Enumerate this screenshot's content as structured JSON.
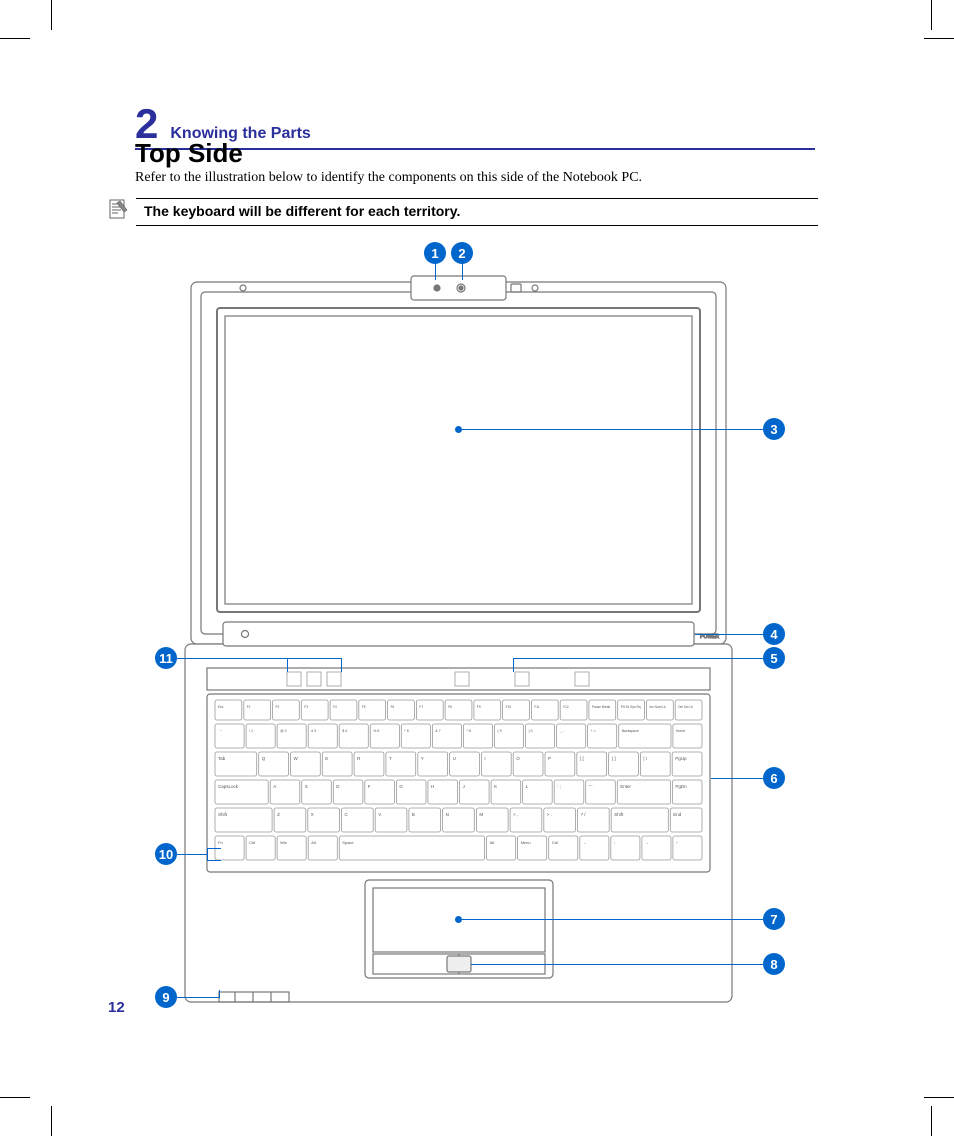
{
  "page_number": "12",
  "chapter": {
    "number": "2",
    "title": "Knowing the Parts"
  },
  "section": {
    "title": "Top Side",
    "intro": "Refer to the illustration below to identify the components on this side of the Notebook PC."
  },
  "note": {
    "text": "The keyboard will be different for each territory."
  },
  "callouts": {
    "c1": "1",
    "c2": "2",
    "c3": "3",
    "c4": "4",
    "c5": "5",
    "c6": "6",
    "c7": "7",
    "c8": "8",
    "c9": "9",
    "c10": "10",
    "c11": "11"
  },
  "labels": {
    "power": "POWER"
  },
  "keyboard": {
    "row_fn": [
      "Esc",
      "F1",
      "F2",
      "F3",
      "F4",
      "F5",
      "F6",
      "F7",
      "F8",
      "F9",
      "F10",
      "F11",
      "F12",
      "Pause Break",
      "Prt Sc Sys Rq",
      "Ins Num Lk",
      "Del Scr Lk"
    ],
    "row_num": [
      "` ~",
      "! 1",
      "@ 2",
      "# 3",
      "$ 4",
      "% 5",
      "^ 6",
      "& 7",
      "* 8",
      "( 9",
      ") 0",
      "_ -",
      "+ =",
      "Backspace",
      "Home"
    ],
    "row_q": [
      "Tab",
      "Q",
      "W",
      "E",
      "R",
      "T",
      "Y",
      "U",
      "I",
      "O",
      "P",
      "{ [",
      "} ]",
      "| \\",
      "PgUp"
    ],
    "row_a": [
      "CapsLock",
      "A",
      "S",
      "D",
      "F",
      "G",
      "H",
      "J",
      "K",
      "L",
      ": ;",
      "\" '",
      "Enter",
      "PgDn"
    ],
    "row_z": [
      "Shift",
      "Z",
      "X",
      "C",
      "V",
      "B",
      "N",
      "M",
      "< ,",
      "> .",
      "? /",
      "Shift",
      "End"
    ],
    "row_ctrl": [
      "Fn",
      "Ctrl",
      "Win",
      "Alt",
      "Space",
      "Alt",
      "Menu",
      "Ctrl",
      "←",
      "↓",
      "→",
      "↑"
    ]
  }
}
